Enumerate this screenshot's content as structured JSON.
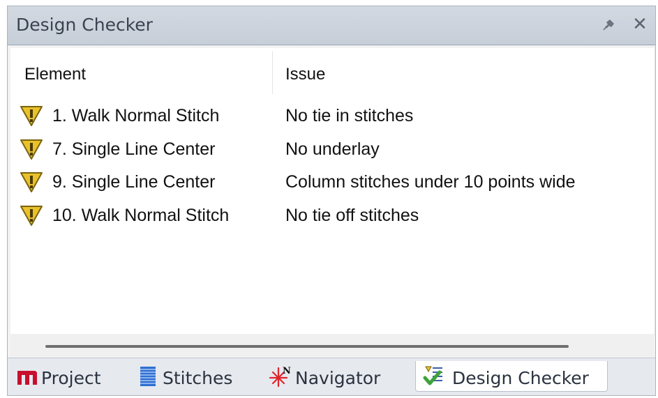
{
  "panel": {
    "title": "Design Checker",
    "pin_icon": "pin-icon",
    "close_icon": "close-icon",
    "close_glyph": "✕"
  },
  "table": {
    "columns": [
      "Element",
      "Issue"
    ],
    "rows": [
      {
        "element": "1. Walk Normal Stitch",
        "issue": "No tie in stitches",
        "icon": "warning-icon"
      },
      {
        "element": "7. Single Line Center",
        "issue": "No underlay",
        "icon": "warning-icon"
      },
      {
        "element": "9. Single Line Center",
        "issue": "Column stitches under 10 points wide",
        "icon": "warning-icon"
      },
      {
        "element": "10. Walk Normal Stitch",
        "issue": "No tie off stitches",
        "icon": "warning-icon"
      }
    ]
  },
  "tabs": [
    {
      "label": "Project",
      "icon": "project-m-icon",
      "active": false
    },
    {
      "label": "Stitches",
      "icon": "stitches-icon",
      "active": false
    },
    {
      "label": "Navigator",
      "icon": "navigator-icon",
      "active": false
    },
    {
      "label": "Design Checker",
      "icon": "design-checker-icon",
      "active": true
    }
  ],
  "colors": {
    "title_bar": "#c9d1db",
    "warning_fill": "#e9c12b",
    "project_icon": "#c8102e",
    "stitches_icon": "#2f6fd1",
    "navigator_icon": "#e0242b",
    "checker_check": "#3ea23a"
  }
}
